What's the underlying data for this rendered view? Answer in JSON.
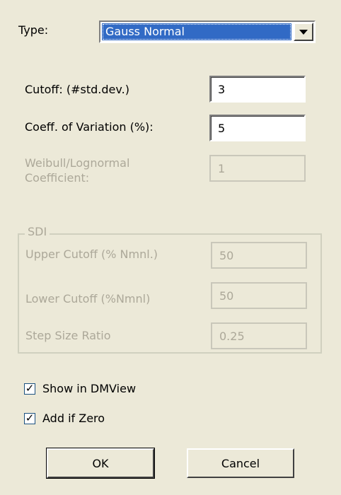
{
  "type": {
    "label": "Type:",
    "selected": "Gauss Normal"
  },
  "fields": {
    "cutoff": {
      "label": "Cutoff: (#std.dev.)",
      "value": "3"
    },
    "coeff_variation": {
      "label": "Coeff. of Variation (%):",
      "value": "5"
    },
    "weibull": {
      "label_line1": "Weibull/Lognormal",
      "label_line2": "Coefficient:",
      "value": "1"
    }
  },
  "sdi": {
    "title": "SDI",
    "upper_cutoff": {
      "label": "Upper Cutoff (% Nmnl.)",
      "value": "50"
    },
    "lower_cutoff": {
      "label": "Lower Cutoff (%Nmnl)",
      "value": "50"
    },
    "step_size_ratio": {
      "label": "Step Size Ratio",
      "value": "0.25"
    }
  },
  "options": {
    "show_in_dmview": {
      "label": "Show in DMView",
      "checked": true
    },
    "add_if_zero": {
      "label": "Add if Zero",
      "checked": true
    }
  },
  "buttons": {
    "ok": "OK",
    "cancel": "Cancel"
  },
  "icons": {
    "combo_arrow": "chevron-down-icon",
    "check": "checkmark-icon"
  }
}
